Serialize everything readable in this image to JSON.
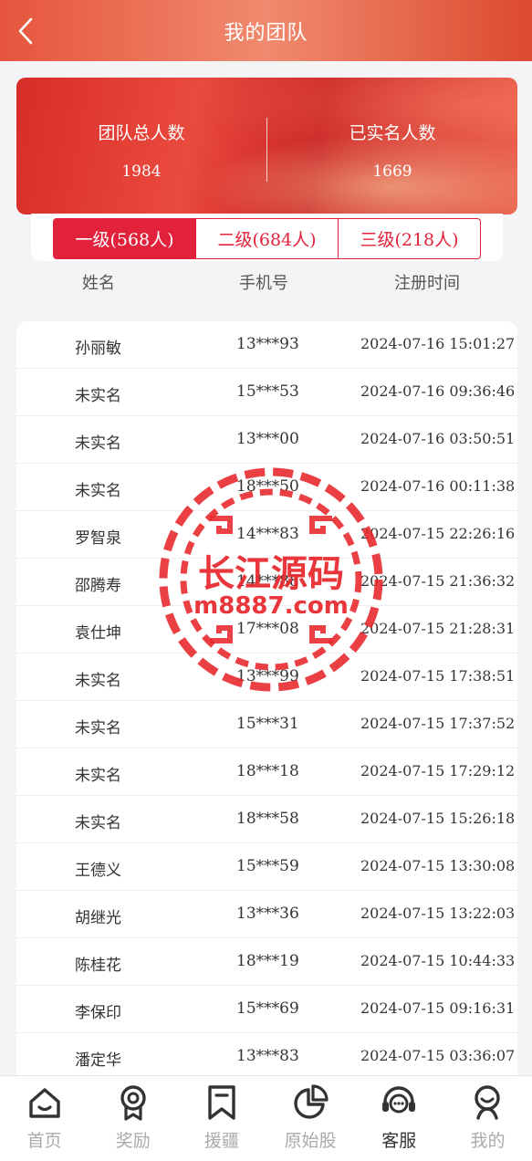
{
  "header": {
    "title": "我的团队"
  },
  "banner": {
    "total_label": "团队总人数",
    "total_value": "1984",
    "verified_label": "已实名人数",
    "verified_value": "1669"
  },
  "tabs": [
    {
      "label": "一级(568人)",
      "active": true
    },
    {
      "label": "二级(684人)",
      "active": false
    },
    {
      "label": "三级(218人)",
      "active": false
    }
  ],
  "columns": {
    "name": "姓名",
    "phone": "手机号",
    "time": "注册时间"
  },
  "rows": [
    {
      "name": "孙丽敏",
      "phone": "13***93",
      "time": "2024-07-16 15:01:27"
    },
    {
      "name": "未实名",
      "phone": "15***53",
      "time": "2024-07-16 09:36:46"
    },
    {
      "name": "未实名",
      "phone": "13***00",
      "time": "2024-07-16 03:50:51"
    },
    {
      "name": "未实名",
      "phone": "18***50",
      "time": "2024-07-16 00:11:38"
    },
    {
      "name": "罗智泉",
      "phone": "14***83",
      "time": "2024-07-15 22:26:16"
    },
    {
      "name": "邵腾寿",
      "phone": "14***88",
      "time": "2024-07-15 21:36:32"
    },
    {
      "name": "袁仕坤",
      "phone": "17***08",
      "time": "2024-07-15 21:28:31"
    },
    {
      "name": "未实名",
      "phone": "13***99",
      "time": "2024-07-15 17:38:51"
    },
    {
      "name": "未实名",
      "phone": "15***31",
      "time": "2024-07-15 17:37:52"
    },
    {
      "name": "未实名",
      "phone": "18***18",
      "time": "2024-07-15 17:29:12"
    },
    {
      "name": "未实名",
      "phone": "18***58",
      "time": "2024-07-15 15:26:18"
    },
    {
      "name": "王德义",
      "phone": "15***59",
      "time": "2024-07-15 13:30:08"
    },
    {
      "name": "胡继光",
      "phone": "13***36",
      "time": "2024-07-15 13:22:03"
    },
    {
      "name": "陈桂花",
      "phone": "18***19",
      "time": "2024-07-15 10:44:33"
    },
    {
      "name": "李保印",
      "phone": "15***69",
      "time": "2024-07-15 09:16:31"
    },
    {
      "name": "潘定华",
      "phone": "13***83",
      "time": "2024-07-15 03:36:07"
    }
  ],
  "watermark": {
    "line1": "长江源码",
    "line2": "m8887.com"
  },
  "tabbar": [
    {
      "label": "首页",
      "icon": "home-icon",
      "active": false
    },
    {
      "label": "奖励",
      "icon": "award-icon",
      "active": false
    },
    {
      "label": "援疆",
      "icon": "bookmark-icon",
      "active": false
    },
    {
      "label": "原始股",
      "icon": "pie-chart-icon",
      "active": false
    },
    {
      "label": "客服",
      "icon": "support-icon",
      "active": true
    },
    {
      "label": "我的",
      "icon": "user-icon",
      "active": false
    }
  ],
  "colors": {
    "accent": "#e2213a",
    "header_start": "#e6553d",
    "watermark": "#e8262b"
  }
}
